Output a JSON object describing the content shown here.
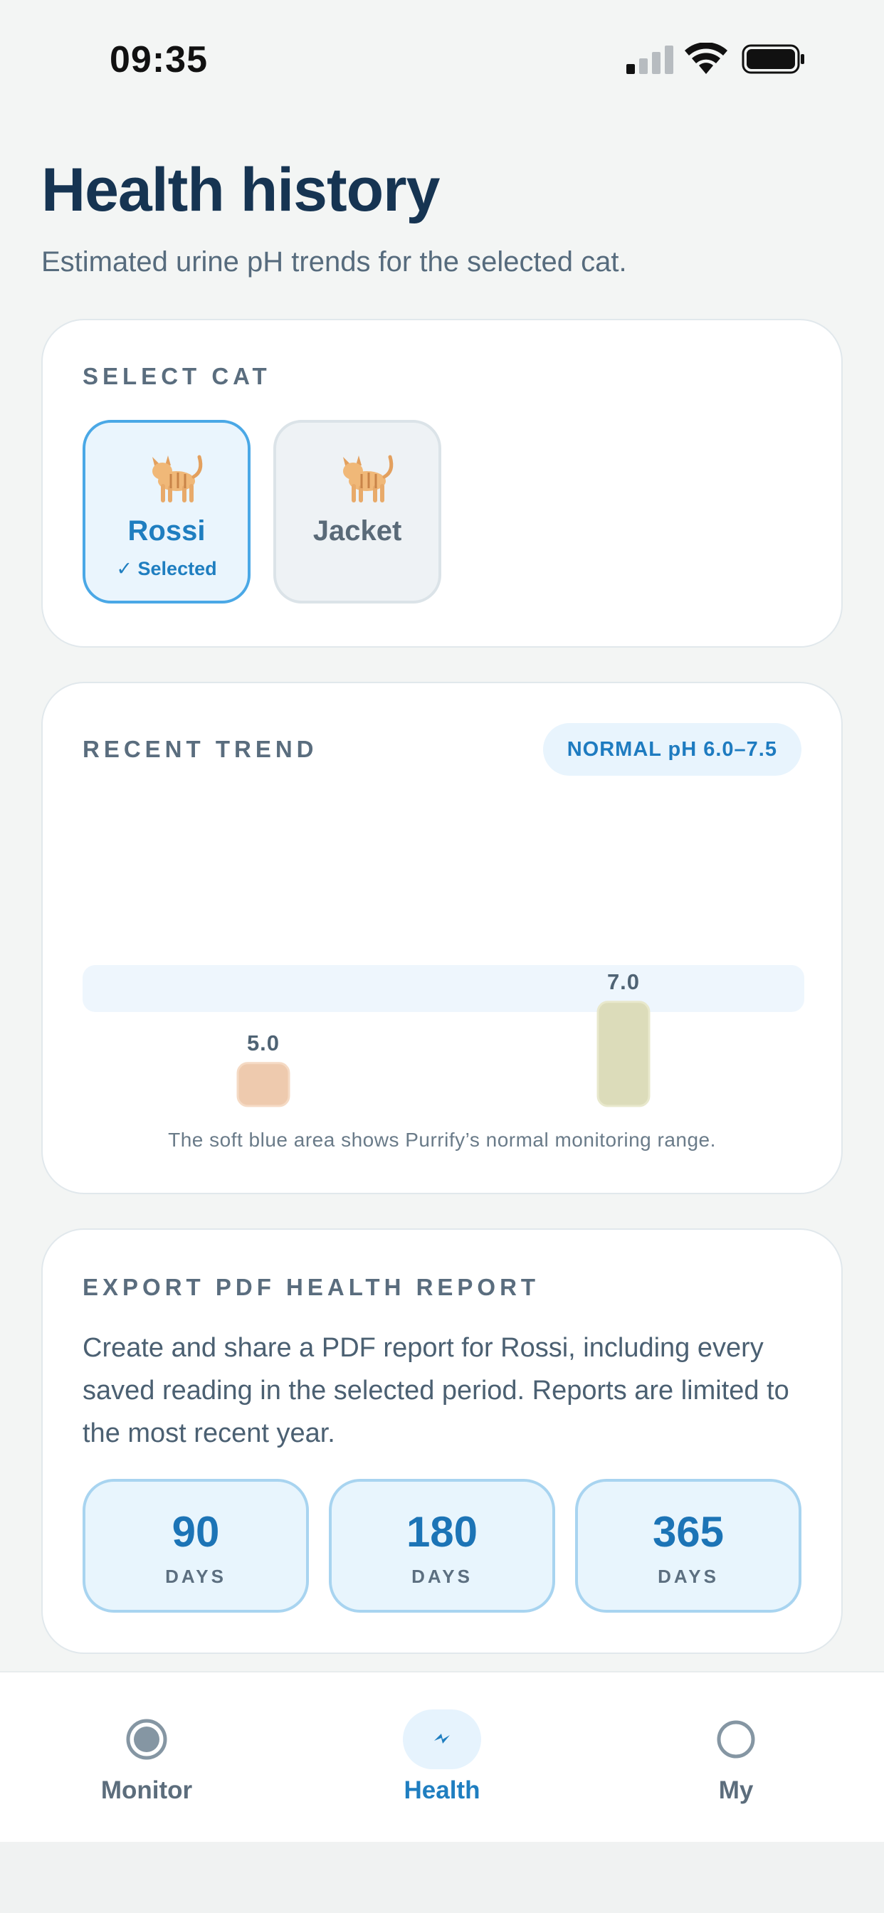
{
  "status_bar": {
    "time": "09:35"
  },
  "header": {
    "title": "Health history",
    "subtitle": "Estimated urine pH trends for the selected cat."
  },
  "select_cat": {
    "label": "SELECT CAT",
    "cats": [
      {
        "name": "Rossi",
        "emoji": "🐈",
        "selected": true,
        "selected_text": "✓ Selected"
      },
      {
        "name": "Jacket",
        "emoji": "🐈",
        "selected": false
      }
    ]
  },
  "trend": {
    "label": "RECENT TREND",
    "range_badge": "NORMAL pH 6.0–7.5",
    "caption": "The soft blue area shows Purrify’s normal monitoring range.",
    "colors": {
      "band": "#eef6fd",
      "low": "#eecaae",
      "normal": "#dcdcba"
    }
  },
  "chart_data": {
    "type": "bar",
    "values": [
      5.0,
      7.0
    ],
    "labels": [
      "5.0",
      "7.0"
    ],
    "normal_range": [
      6.0,
      7.5
    ]
  },
  "export": {
    "label": "EXPORT PDF HEALTH REPORT",
    "description": "Create and share a PDF report for Rossi, including every saved reading in the selected period. Reports are limited to the most recent year.",
    "periods": [
      {
        "value": "90",
        "unit": "DAYS"
      },
      {
        "value": "180",
        "unit": "DAYS"
      },
      {
        "value": "365",
        "unit": "DAYS"
      }
    ]
  },
  "tabs": [
    {
      "label": "Monitor",
      "icon": "monitor-icon",
      "active": false
    },
    {
      "label": "Health",
      "icon": "health-icon",
      "active": true
    },
    {
      "label": "My",
      "icon": "profile-icon",
      "active": false
    }
  ],
  "accent_color": "#1f7ec0"
}
